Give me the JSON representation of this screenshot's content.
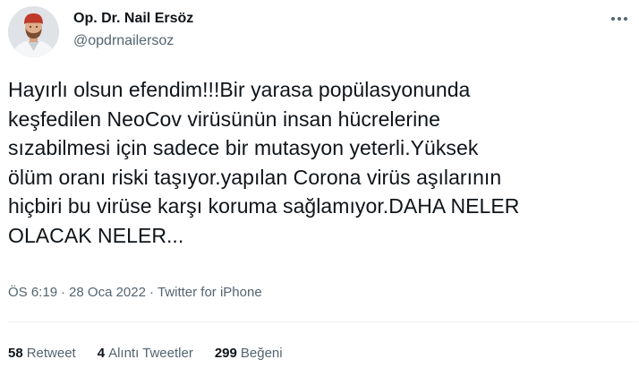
{
  "author": {
    "display_name": "Op. Dr. Nail Ersöz",
    "handle": "@opdrnailersoz",
    "avatar_icon": "profile-photo"
  },
  "more_icon": "more-horizontal-icon",
  "tweet": {
    "text": "Hayırlı olsun efendim!!!Bir yarasa popülasyonunda\nkeşfedilen NeoCov virüsünün insan hücrelerine\nsızabilmesi için sadece bir mutasyon yeterli.Yüksek\nölüm oranı riski taşıyor.yapılan Corona virüs aşılarının\nhiçbiri bu virüse karşı koruma sağlamıyor.DAHA NELER\nOLACAK NELER..."
  },
  "meta": {
    "time": "ÖS 6:19",
    "separator": "·",
    "date": "28 Oca 2022",
    "source": "Twitter for iPhone"
  },
  "stats": {
    "retweets": {
      "count": "58",
      "label": "Retweet"
    },
    "quotes": {
      "count": "4",
      "label": "Alıntı Tweetler"
    },
    "likes": {
      "count": "299",
      "label": "Beğeni"
    }
  },
  "colors": {
    "text_primary": "#0f1419",
    "text_secondary": "#536471",
    "divider": "#eff3f4"
  }
}
